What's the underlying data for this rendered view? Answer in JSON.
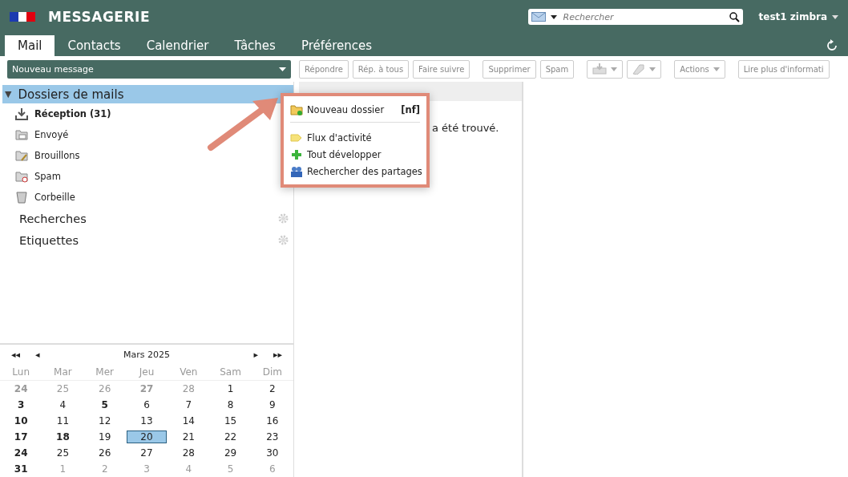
{
  "app": {
    "title": "MESSAGERIE",
    "user": "test1 zimbra"
  },
  "search": {
    "placeholder": "Rechercher"
  },
  "tabs": [
    {
      "label": "Mail",
      "selected": true
    },
    {
      "label": "Contacts",
      "selected": false
    },
    {
      "label": "Calendrier",
      "selected": false
    },
    {
      "label": "Tâches",
      "selected": false
    },
    {
      "label": "Préférences",
      "selected": false
    }
  ],
  "new_message": "Nouveau message",
  "toolbar": [
    {
      "kind": "text",
      "label": "Répondre"
    },
    {
      "kind": "text",
      "label": "Rép. à tous"
    },
    {
      "kind": "text",
      "label": "Faire suivre"
    },
    {
      "kind": "gap"
    },
    {
      "kind": "text",
      "label": "Supprimer"
    },
    {
      "kind": "text",
      "label": "Spam"
    },
    {
      "kind": "gap"
    },
    {
      "kind": "move"
    },
    {
      "kind": "tag"
    },
    {
      "kind": "gap"
    },
    {
      "kind": "menu",
      "label": "Actions"
    },
    {
      "kind": "gap"
    },
    {
      "kind": "text",
      "label": "Lire plus d'informati"
    }
  ],
  "sidebar": {
    "toggle": "▼",
    "header": "Dossiers de mails",
    "expanded": true,
    "folders": [
      {
        "kind": "inbox",
        "label": "Réception (31)",
        "unread": true
      },
      {
        "kind": "sent",
        "label": "Envoyé",
        "unread": false
      },
      {
        "kind": "drafts",
        "label": "Brouillons",
        "unread": false
      },
      {
        "kind": "spam",
        "label": "Spam",
        "unread": false
      },
      {
        "kind": "trash",
        "label": "Corbeille",
        "unread": false
      }
    ],
    "sections": [
      "Recherches",
      "Etiquettes"
    ]
  },
  "message_list": {
    "empty_text": "a été trouvé."
  },
  "context_menu": [
    {
      "kind": "new-folder",
      "label": "Nouveau dossier",
      "shortcut": "[nf]"
    },
    {
      "kind": "separator"
    },
    {
      "kind": "feed",
      "label": "Flux d'activité"
    },
    {
      "kind": "expand",
      "label": "Tout développer"
    },
    {
      "kind": "share",
      "label": "Rechercher des partages"
    }
  ],
  "calendar": {
    "nav": [
      "◂◂",
      "◂",
      "▸",
      "▸▸"
    ],
    "month": "Mars 2025",
    "weekdays": [
      "Lun",
      "Mar",
      "Mer",
      "Jeu",
      "Ven",
      "Sam",
      "Dim"
    ],
    "weeks": [
      [
        {
          "day": "24",
          "muted": true,
          "bold": true,
          "selected": false
        },
        {
          "day": "25",
          "muted": true,
          "bold": false,
          "selected": false
        },
        {
          "day": "26",
          "muted": true,
          "bold": false,
          "selected": false
        },
        {
          "day": "27",
          "muted": true,
          "bold": true,
          "selected": false
        },
        {
          "day": "28",
          "muted": true,
          "bold": false,
          "selected": false
        },
        {
          "day": "1",
          "muted": false,
          "bold": false,
          "selected": false
        },
        {
          "day": "2",
          "muted": false,
          "bold": false,
          "selected": false
        }
      ],
      [
        {
          "day": "3",
          "muted": false,
          "bold": true,
          "selected": false
        },
        {
          "day": "4",
          "muted": false,
          "bold": false,
          "selected": false
        },
        {
          "day": "5",
          "muted": false,
          "bold": true,
          "selected": false
        },
        {
          "day": "6",
          "muted": false,
          "bold": false,
          "selected": false
        },
        {
          "day": "7",
          "muted": false,
          "bold": false,
          "selected": false
        },
        {
          "day": "8",
          "muted": false,
          "bold": false,
          "selected": false
        },
        {
          "day": "9",
          "muted": false,
          "bold": false,
          "selected": false
        }
      ],
      [
        {
          "day": "10",
          "muted": false,
          "bold": true,
          "selected": false
        },
        {
          "day": "11",
          "muted": false,
          "bold": false,
          "selected": false
        },
        {
          "day": "12",
          "muted": false,
          "bold": false,
          "selected": false
        },
        {
          "day": "13",
          "muted": false,
          "bold": false,
          "selected": false
        },
        {
          "day": "14",
          "muted": false,
          "bold": false,
          "selected": false
        },
        {
          "day": "15",
          "muted": false,
          "bold": false,
          "selected": false
        },
        {
          "day": "16",
          "muted": false,
          "bold": false,
          "selected": false
        }
      ],
      [
        {
          "day": "17",
          "muted": false,
          "bold": true,
          "selected": false
        },
        {
          "day": "18",
          "muted": false,
          "bold": true,
          "selected": false
        },
        {
          "day": "19",
          "muted": false,
          "bold": false,
          "selected": false
        },
        {
          "day": "20",
          "muted": false,
          "bold": false,
          "selected": true
        },
        {
          "day": "21",
          "muted": false,
          "bold": false,
          "selected": false
        },
        {
          "day": "22",
          "muted": false,
          "bold": false,
          "selected": false
        },
        {
          "day": "23",
          "muted": false,
          "bold": false,
          "selected": false
        }
      ],
      [
        {
          "day": "24",
          "muted": false,
          "bold": true,
          "selected": false
        },
        {
          "day": "25",
          "muted": false,
          "bold": false,
          "selected": false
        },
        {
          "day": "26",
          "muted": false,
          "bold": false,
          "selected": false
        },
        {
          "day": "27",
          "muted": false,
          "bold": false,
          "selected": false
        },
        {
          "day": "28",
          "muted": false,
          "bold": false,
          "selected": false
        },
        {
          "day": "29",
          "muted": false,
          "bold": false,
          "selected": false
        },
        {
          "day": "30",
          "muted": false,
          "bold": false,
          "selected": false
        }
      ],
      [
        {
          "day": "31",
          "muted": false,
          "bold": true,
          "selected": false
        },
        {
          "day": "1",
          "muted": true,
          "bold": false,
          "selected": false
        },
        {
          "day": "2",
          "muted": true,
          "bold": false,
          "selected": false
        },
        {
          "day": "3",
          "muted": true,
          "bold": false,
          "selected": false
        },
        {
          "day": "4",
          "muted": true,
          "bold": false,
          "selected": false
        },
        {
          "day": "5",
          "muted": true,
          "bold": false,
          "selected": false
        },
        {
          "day": "6",
          "muted": true,
          "bold": false,
          "selected": false
        }
      ]
    ]
  }
}
